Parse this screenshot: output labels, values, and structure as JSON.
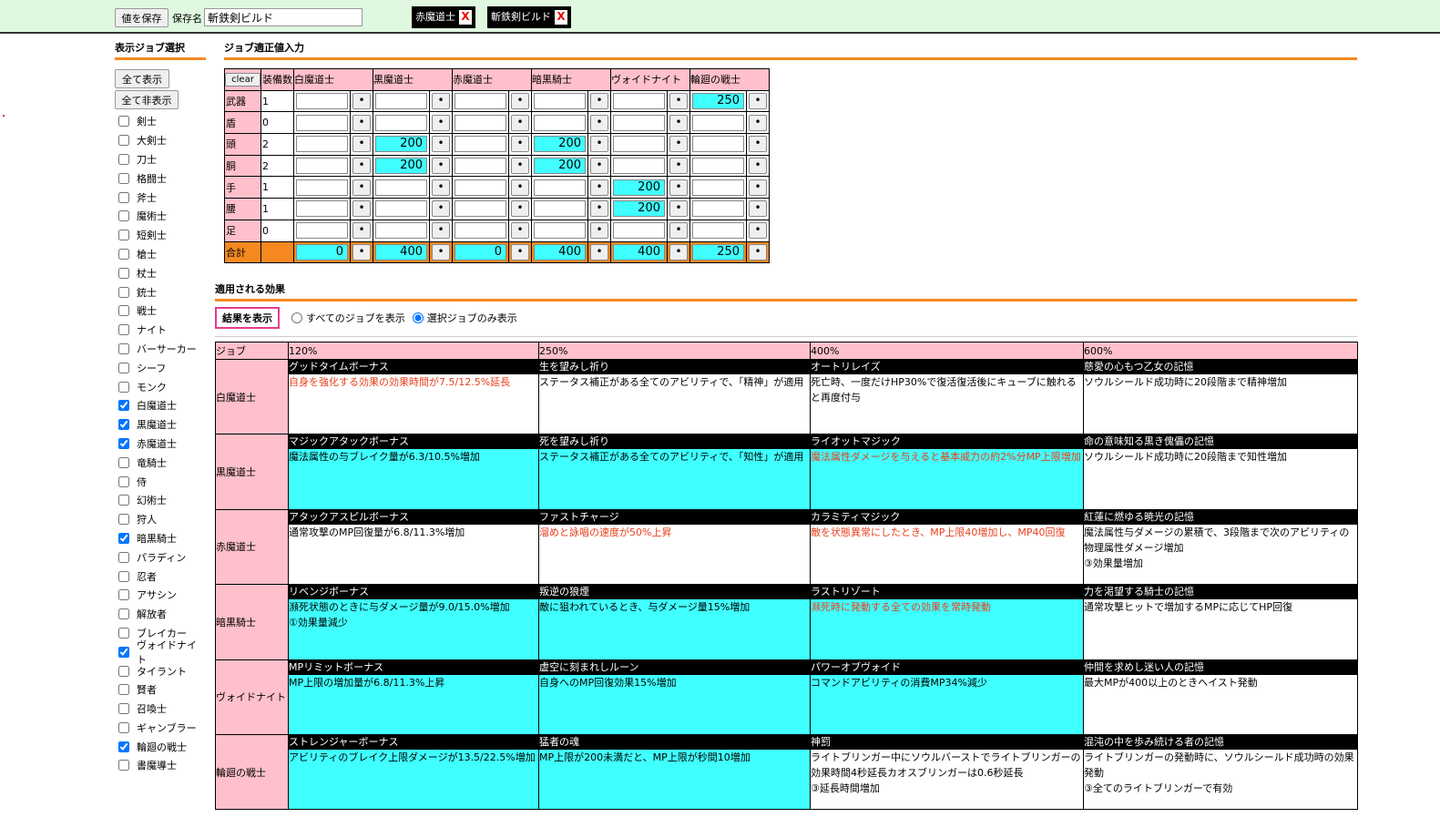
{
  "top": {
    "save_button": "値を保存",
    "save_label": "保存名",
    "save_name": "斬鉄剣ビルド",
    "presets": [
      "赤魔道士",
      "斬鉄剣ビルド"
    ],
    "close": "X"
  },
  "sidebar": {
    "title": "表示ジョブ選択",
    "show_all": "全て表示",
    "hide_all": "全て非表示",
    "jobs": [
      {
        "name": "剣士",
        "checked": false
      },
      {
        "name": "大剣士",
        "checked": false
      },
      {
        "name": "刀士",
        "checked": false
      },
      {
        "name": "格闘士",
        "checked": false
      },
      {
        "name": "斧士",
        "checked": false
      },
      {
        "name": "魔術士",
        "checked": false
      },
      {
        "name": "短剣士",
        "checked": false
      },
      {
        "name": "槍士",
        "checked": false
      },
      {
        "name": "杖士",
        "checked": false
      },
      {
        "name": "銃士",
        "checked": false
      },
      {
        "name": "戦士",
        "checked": false
      },
      {
        "name": "ナイト",
        "checked": false
      },
      {
        "name": "バーサーカー",
        "checked": false
      },
      {
        "name": "シーフ",
        "checked": false
      },
      {
        "name": "モンク",
        "checked": false
      },
      {
        "name": "白魔道士",
        "checked": true
      },
      {
        "name": "黒魔道士",
        "checked": true
      },
      {
        "name": "赤魔道士",
        "checked": true
      },
      {
        "name": "竜騎士",
        "checked": false
      },
      {
        "name": "侍",
        "checked": false
      },
      {
        "name": "幻術士",
        "checked": false
      },
      {
        "name": "狩人",
        "checked": false
      },
      {
        "name": "暗黒騎士",
        "checked": true
      },
      {
        "name": "パラディン",
        "checked": false
      },
      {
        "name": "忍者",
        "checked": false
      },
      {
        "name": "アサシン",
        "checked": false
      },
      {
        "name": "解放者",
        "checked": false
      },
      {
        "name": "ブレイカー",
        "checked": false
      },
      {
        "name": "ヴォイドナイト",
        "checked": true
      },
      {
        "name": "タイラント",
        "checked": false
      },
      {
        "name": "賢者",
        "checked": false
      },
      {
        "name": "召喚士",
        "checked": false
      },
      {
        "name": "ギャンブラー",
        "checked": false
      },
      {
        "name": "輪廻の戦士",
        "checked": true
      },
      {
        "name": "書魔導士",
        "checked": false
      }
    ]
  },
  "aptitude": {
    "title": "ジョブ適正値入力",
    "clear": "clear",
    "count_header": "装備数",
    "dot": "•",
    "jobs": [
      "白魔道士",
      "黒魔道士",
      "赤魔道士",
      "暗黒騎士",
      "ヴォイドナイト",
      "輪廻の戦士"
    ],
    "rows": [
      {
        "label": "武器",
        "count": "1",
        "values": [
          "",
          "",
          "",
          "",
          "",
          "250"
        ]
      },
      {
        "label": "盾",
        "count": "0",
        "values": [
          "",
          "",
          "",
          "",
          "",
          ""
        ]
      },
      {
        "label": "頭",
        "count": "2",
        "values": [
          "",
          "200",
          "",
          "200",
          "",
          ""
        ]
      },
      {
        "label": "胴",
        "count": "2",
        "values": [
          "",
          "200",
          "",
          "200",
          "",
          ""
        ]
      },
      {
        "label": "手",
        "count": "1",
        "values": [
          "",
          "",
          "",
          "",
          "200",
          ""
        ]
      },
      {
        "label": "腰",
        "count": "1",
        "values": [
          "",
          "",
          "",
          "",
          "200",
          ""
        ]
      },
      {
        "label": "足",
        "count": "0",
        "values": [
          "",
          "",
          "",
          "",
          "",
          ""
        ]
      }
    ],
    "total": {
      "label": "合計",
      "values": [
        "0",
        "400",
        "0",
        "400",
        "400",
        "250"
      ]
    }
  },
  "effects": {
    "title": "適用される効果",
    "result_button": "結果を表示",
    "radio_all": "すべてのジョブを表示",
    "radio_selected": "選択ジョブのみ表示",
    "headers": [
      "ジョブ",
      "120%",
      "250%",
      "400%",
      "600%"
    ],
    "rows": [
      {
        "job": "白魔道士",
        "cells": [
          {
            "title": "グッドタイムボーナス",
            "desc": "自身を強化する効果の効果時間が7.5/12.5%延長",
            "red": true,
            "cyan": false
          },
          {
            "title": "生を望みし祈り",
            "desc": "ステータス補正がある全てのアビリティで、「精神」が適用",
            "red": false,
            "cyan": false
          },
          {
            "title": "オートリレイズ",
            "desc": "死亡時、一度だけHP30%で復活復活後にキューブに触れると再度付与",
            "red": false,
            "cyan": false
          },
          {
            "title": "慈愛の心もつ乙女の記憶",
            "desc": "ソウルシールド成功時に20段階まで精神増加",
            "red": false,
            "cyan": false
          }
        ]
      },
      {
        "job": "黒魔道士",
        "cells": [
          {
            "title": "マジックアタックボーナス",
            "desc": "魔法属性の与ブレイク量が6.3/10.5%増加",
            "red": false,
            "cyan": true
          },
          {
            "title": "死を望みし祈り",
            "desc": "ステータス補正がある全てのアビリティで、「知性」が適用",
            "red": false,
            "cyan": true
          },
          {
            "title": "ライオットマジック",
            "desc": "魔法属性ダメージを与えると基本威力の約2%分MP上限増加",
            "red": true,
            "cyan": true
          },
          {
            "title": "命の意味知る黒き傀儡の記憶",
            "desc": "ソウルシールド成功時に20段階まで知性増加",
            "red": false,
            "cyan": false
          }
        ]
      },
      {
        "job": "赤魔道士",
        "cells": [
          {
            "title": "アタックアスピルボーナス",
            "desc": "通常攻撃のMP回復量が6.8/11.3%増加",
            "red": false,
            "cyan": false
          },
          {
            "title": "ファストチャージ",
            "desc": "溜めと詠唱の速度が50%上昇",
            "red": true,
            "cyan": false
          },
          {
            "title": "カラミティマジック",
            "desc": "敵を状態異常にしたとき、MP上限40増加し、MP40回復",
            "red": true,
            "cyan": false
          },
          {
            "title": "紅蓮に燃ゆる暁光の記憶",
            "desc": "魔法属性与ダメージの累積で、3段階まで次のアビリティの物理属性ダメージ増加\n③効果量増加",
            "red": false,
            "cyan": false
          }
        ]
      },
      {
        "job": "暗黒騎士",
        "cells": [
          {
            "title": "リベンジボーナス",
            "desc": "瀕死状態のときに与ダメージ量が9.0/15.0%増加\n①効果量減少",
            "red": false,
            "cyan": true
          },
          {
            "title": "叛逆の狼煙",
            "desc": "敵に狙われているとき、与ダメージ量15%増加",
            "red": false,
            "cyan": true
          },
          {
            "title": "ラストリゾート",
            "desc": "瀕死時に発動する全ての効果を常時発動",
            "red": true,
            "cyan": true
          },
          {
            "title": "力を渇望する騎士の記憶",
            "desc": "通常攻撃ヒットで増加するMPに応じてHP回復",
            "red": false,
            "cyan": false
          }
        ]
      },
      {
        "job": "ヴォイドナイト",
        "cells": [
          {
            "title": "MPリミットボーナス",
            "desc": "MP上限の増加量が6.8/11.3%上昇",
            "red": false,
            "cyan": true
          },
          {
            "title": "虚空に刻まれしルーン",
            "desc": "自身へのMP回復効果15%増加",
            "red": false,
            "cyan": true
          },
          {
            "title": "パワーオブヴォイド",
            "desc": "コマンドアビリティの消費MP34%減少",
            "red": false,
            "cyan": true
          },
          {
            "title": "仲間を求めし迷い人の記憶",
            "desc": "最大MPが400以上のときヘイスト発動",
            "red": false,
            "cyan": false
          }
        ]
      },
      {
        "job": "輪廻の戦士",
        "cells": [
          {
            "title": "ストレンジャーボーナス",
            "desc": "アビリティのブレイク上限ダメージが13.5/22.5%増加",
            "red": false,
            "cyan": true
          },
          {
            "title": "猛者の魂",
            "desc": "MP上限が200未満だと、MP上限が秒間10増加",
            "red": false,
            "cyan": true
          },
          {
            "title": "神罰",
            "desc": "ライトブリンガー中にソウルバーストでライトブリンガーの効果時間4秒延長カオスブリンガーは0.6秒延長\n③延長時間増加",
            "red": false,
            "cyan": false
          },
          {
            "title": "混沌の中を歩み続ける者の記憶",
            "desc": "ライトブリンガーの発動時に、ソウルシールド成功時の効果発動\n③全てのライトブリンガーで有効",
            "red": false,
            "cyan": false
          }
        ]
      }
    ]
  },
  "colors": {
    "accent": "#f5891f",
    "pink": "#ffc0cb",
    "cyan": "#40ffff",
    "topbar": "#e0f8e0",
    "red_text": "#e8401c"
  }
}
